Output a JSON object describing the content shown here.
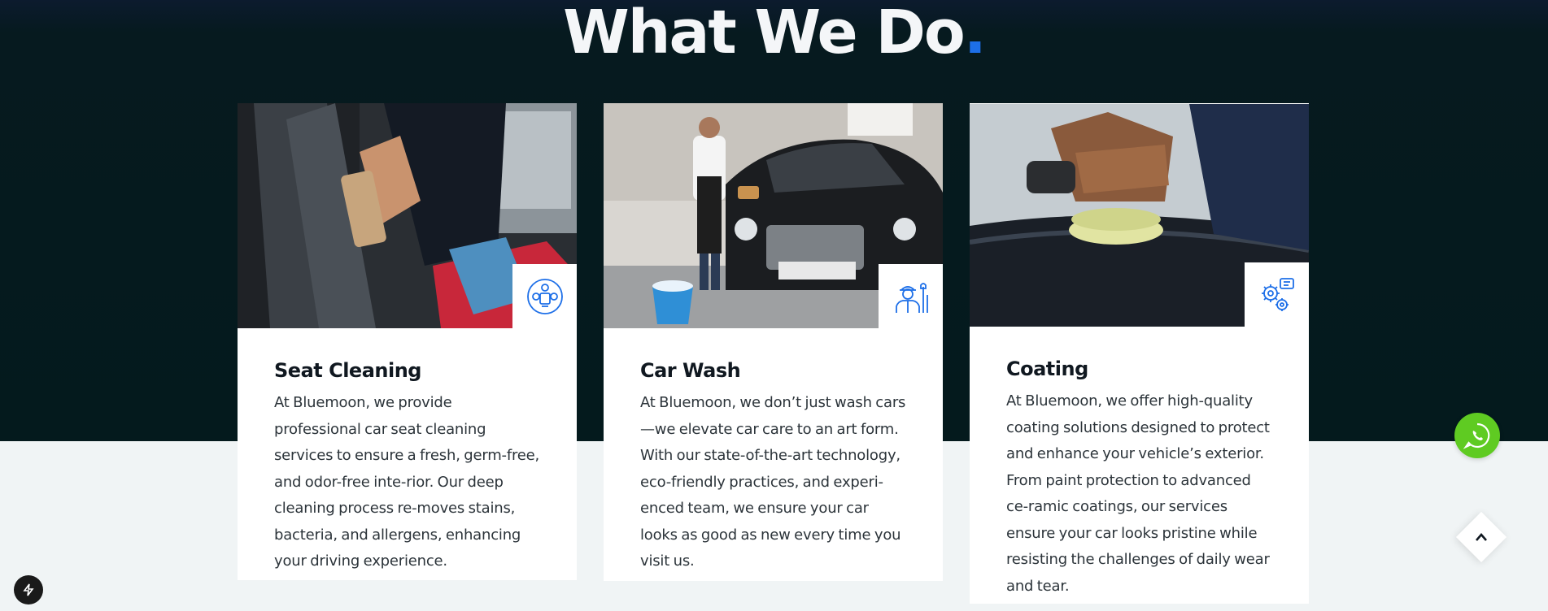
{
  "section": {
    "title": "What We Do",
    "title_dot": "."
  },
  "colors": {
    "accent": "#1d6fe8",
    "dark_bg": "#041a1d",
    "light_bg": "#f0f4f5",
    "whatsapp": "#5fcb22"
  },
  "cards": [
    {
      "title": "Seat Cleaning",
      "icon": "seat-cleaning-icon",
      "text": "At Bluemoon, we provide professional car seat cleaning services to ensure a fresh, germ-free, and odor-free inte-rior. Our deep cleaning process re-moves stains, bacteria, and allergens, enhancing your driving experience."
    },
    {
      "title": "Car Wash",
      "icon": "mechanic-icon",
      "text": "At Bluemoon, we don’t just wash cars—we elevate car care to an art form. With our state-of-the-art technology, eco-friendly practices, and experi-enced team, we ensure your car looks as good as new every time you visit us."
    },
    {
      "title": "Coating",
      "icon": "gears-icon",
      "text": "At Bluemoon, we offer high-quality coating solutions designed to protect and enhance your vehicle’s exterior. From paint protection to advanced ce-ramic coatings, our services ensure your car looks pristine while resisting the challenges of daily wear and tear."
    }
  ],
  "floating": {
    "whatsapp_icon": "whatsapp-icon",
    "scroll_top_icon": "chevron-up-icon",
    "bolt_icon": "bolt-icon"
  }
}
